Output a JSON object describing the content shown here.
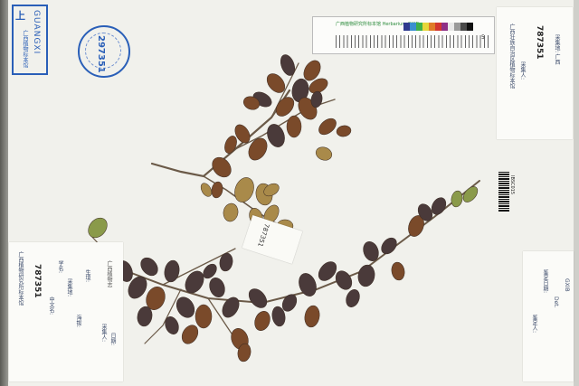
{
  "stamp_box": {
    "glyph": "上",
    "vertical_text": "GUANGXI",
    "chinese_text": "广西植物标本馆"
  },
  "round_stamp": {
    "number": "297351"
  },
  "color_bar": {
    "title": "广西植物研究所标本馆 Herbarium  GXIB",
    "ruler_end": "5",
    "chips": [
      "#2f3a8f",
      "#3a8fd0",
      "#3fb04a",
      "#e6d63a",
      "#e07b27",
      "#d3362f",
      "#8e2f86",
      "#e8e8e8",
      "#9a9a9a",
      "#4a4a4a",
      "#111111"
    ]
  },
  "right_label": {
    "number": "787351",
    "lines": [
      "广西壮族自治区植物标本馆",
      "采集地: 广西",
      "采集人:"
    ]
  },
  "left_label": {
    "number": "787351",
    "lines": [
      "广西植物研究所标本馆",
      "中文名:",
      "学名:",
      "采集地:",
      "海拔:",
      "生境:",
      "采集人:",
      "日期:"
    ]
  },
  "left_note": {
    "text": "广西植物志"
  },
  "bottom_right_label": {
    "lines": [
      "鉴定人:",
      "鉴定日期:",
      "Det.",
      "GXIB"
    ]
  },
  "barcode": {
    "number": "IBSC015"
  },
  "tag": {
    "text": "787351"
  },
  "leaf_colors": {
    "dark": "#4a3a3a",
    "brown": "#7a4a2a",
    "tan": "#a98a4a",
    "green": "#8a9a4a"
  }
}
